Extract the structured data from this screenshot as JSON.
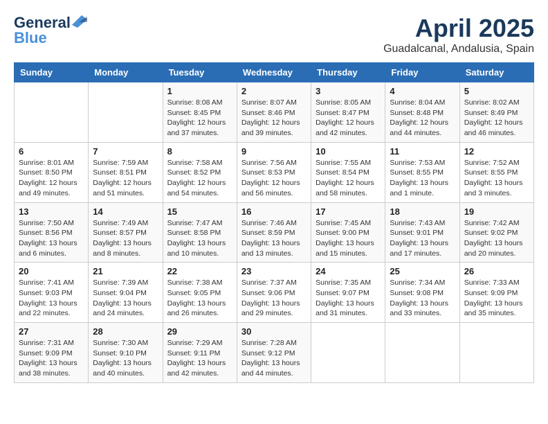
{
  "header": {
    "logo_general": "General",
    "logo_blue": "Blue",
    "title": "April 2025",
    "location": "Guadalcanal, Andalusia, Spain"
  },
  "calendar": {
    "weekdays": [
      "Sunday",
      "Monday",
      "Tuesday",
      "Wednesday",
      "Thursday",
      "Friday",
      "Saturday"
    ],
    "weeks": [
      [
        {
          "day": "",
          "info": ""
        },
        {
          "day": "",
          "info": ""
        },
        {
          "day": "1",
          "info": "Sunrise: 8:08 AM\nSunset: 8:45 PM\nDaylight: 12 hours and 37 minutes."
        },
        {
          "day": "2",
          "info": "Sunrise: 8:07 AM\nSunset: 8:46 PM\nDaylight: 12 hours and 39 minutes."
        },
        {
          "day": "3",
          "info": "Sunrise: 8:05 AM\nSunset: 8:47 PM\nDaylight: 12 hours and 42 minutes."
        },
        {
          "day": "4",
          "info": "Sunrise: 8:04 AM\nSunset: 8:48 PM\nDaylight: 12 hours and 44 minutes."
        },
        {
          "day": "5",
          "info": "Sunrise: 8:02 AM\nSunset: 8:49 PM\nDaylight: 12 hours and 46 minutes."
        }
      ],
      [
        {
          "day": "6",
          "info": "Sunrise: 8:01 AM\nSunset: 8:50 PM\nDaylight: 12 hours and 49 minutes."
        },
        {
          "day": "7",
          "info": "Sunrise: 7:59 AM\nSunset: 8:51 PM\nDaylight: 12 hours and 51 minutes."
        },
        {
          "day": "8",
          "info": "Sunrise: 7:58 AM\nSunset: 8:52 PM\nDaylight: 12 hours and 54 minutes."
        },
        {
          "day": "9",
          "info": "Sunrise: 7:56 AM\nSunset: 8:53 PM\nDaylight: 12 hours and 56 minutes."
        },
        {
          "day": "10",
          "info": "Sunrise: 7:55 AM\nSunset: 8:54 PM\nDaylight: 12 hours and 58 minutes."
        },
        {
          "day": "11",
          "info": "Sunrise: 7:53 AM\nSunset: 8:55 PM\nDaylight: 13 hours and 1 minute."
        },
        {
          "day": "12",
          "info": "Sunrise: 7:52 AM\nSunset: 8:55 PM\nDaylight: 13 hours and 3 minutes."
        }
      ],
      [
        {
          "day": "13",
          "info": "Sunrise: 7:50 AM\nSunset: 8:56 PM\nDaylight: 13 hours and 6 minutes."
        },
        {
          "day": "14",
          "info": "Sunrise: 7:49 AM\nSunset: 8:57 PM\nDaylight: 13 hours and 8 minutes."
        },
        {
          "day": "15",
          "info": "Sunrise: 7:47 AM\nSunset: 8:58 PM\nDaylight: 13 hours and 10 minutes."
        },
        {
          "day": "16",
          "info": "Sunrise: 7:46 AM\nSunset: 8:59 PM\nDaylight: 13 hours and 13 minutes."
        },
        {
          "day": "17",
          "info": "Sunrise: 7:45 AM\nSunset: 9:00 PM\nDaylight: 13 hours and 15 minutes."
        },
        {
          "day": "18",
          "info": "Sunrise: 7:43 AM\nSunset: 9:01 PM\nDaylight: 13 hours and 17 minutes."
        },
        {
          "day": "19",
          "info": "Sunrise: 7:42 AM\nSunset: 9:02 PM\nDaylight: 13 hours and 20 minutes."
        }
      ],
      [
        {
          "day": "20",
          "info": "Sunrise: 7:41 AM\nSunset: 9:03 PM\nDaylight: 13 hours and 22 minutes."
        },
        {
          "day": "21",
          "info": "Sunrise: 7:39 AM\nSunset: 9:04 PM\nDaylight: 13 hours and 24 minutes."
        },
        {
          "day": "22",
          "info": "Sunrise: 7:38 AM\nSunset: 9:05 PM\nDaylight: 13 hours and 26 minutes."
        },
        {
          "day": "23",
          "info": "Sunrise: 7:37 AM\nSunset: 9:06 PM\nDaylight: 13 hours and 29 minutes."
        },
        {
          "day": "24",
          "info": "Sunrise: 7:35 AM\nSunset: 9:07 PM\nDaylight: 13 hours and 31 minutes."
        },
        {
          "day": "25",
          "info": "Sunrise: 7:34 AM\nSunset: 9:08 PM\nDaylight: 13 hours and 33 minutes."
        },
        {
          "day": "26",
          "info": "Sunrise: 7:33 AM\nSunset: 9:09 PM\nDaylight: 13 hours and 35 minutes."
        }
      ],
      [
        {
          "day": "27",
          "info": "Sunrise: 7:31 AM\nSunset: 9:09 PM\nDaylight: 13 hours and 38 minutes."
        },
        {
          "day": "28",
          "info": "Sunrise: 7:30 AM\nSunset: 9:10 PM\nDaylight: 13 hours and 40 minutes."
        },
        {
          "day": "29",
          "info": "Sunrise: 7:29 AM\nSunset: 9:11 PM\nDaylight: 13 hours and 42 minutes."
        },
        {
          "day": "30",
          "info": "Sunrise: 7:28 AM\nSunset: 9:12 PM\nDaylight: 13 hours and 44 minutes."
        },
        {
          "day": "",
          "info": ""
        },
        {
          "day": "",
          "info": ""
        },
        {
          "day": "",
          "info": ""
        }
      ]
    ]
  }
}
